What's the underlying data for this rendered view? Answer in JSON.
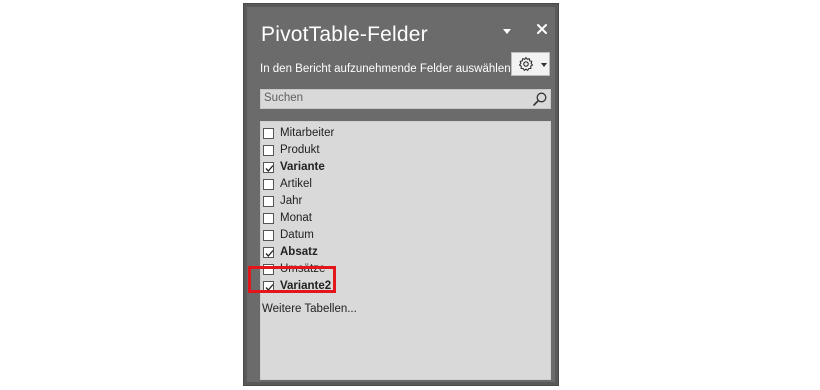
{
  "pane": {
    "title": "PivotTable-Felder",
    "subtitle": "In den Bericht aufzunehmende Felder auswählen:",
    "options_icon": "gear-icon",
    "menu_icon": "chevron-down-icon",
    "close_icon": "close-icon"
  },
  "search": {
    "placeholder": "Suchen",
    "icon": "search-icon"
  },
  "fields": [
    {
      "label": "Mitarbeiter",
      "checked": false
    },
    {
      "label": "Produkt",
      "checked": false
    },
    {
      "label": "Variante",
      "checked": true
    },
    {
      "label": "Artikel",
      "checked": false
    },
    {
      "label": "Jahr",
      "checked": false
    },
    {
      "label": "Monat",
      "checked": false
    },
    {
      "label": "Datum",
      "checked": false
    },
    {
      "label": "Absatz",
      "checked": true
    },
    {
      "label": "Umsätze",
      "checked": false
    },
    {
      "label": "Variante2",
      "checked": true
    }
  ],
  "more_tables": "Weitere Tabellen...",
  "colors": {
    "pane_bg": "#6b6b6b",
    "list_bg": "#d9d9d9",
    "highlight": "#e4161c"
  }
}
